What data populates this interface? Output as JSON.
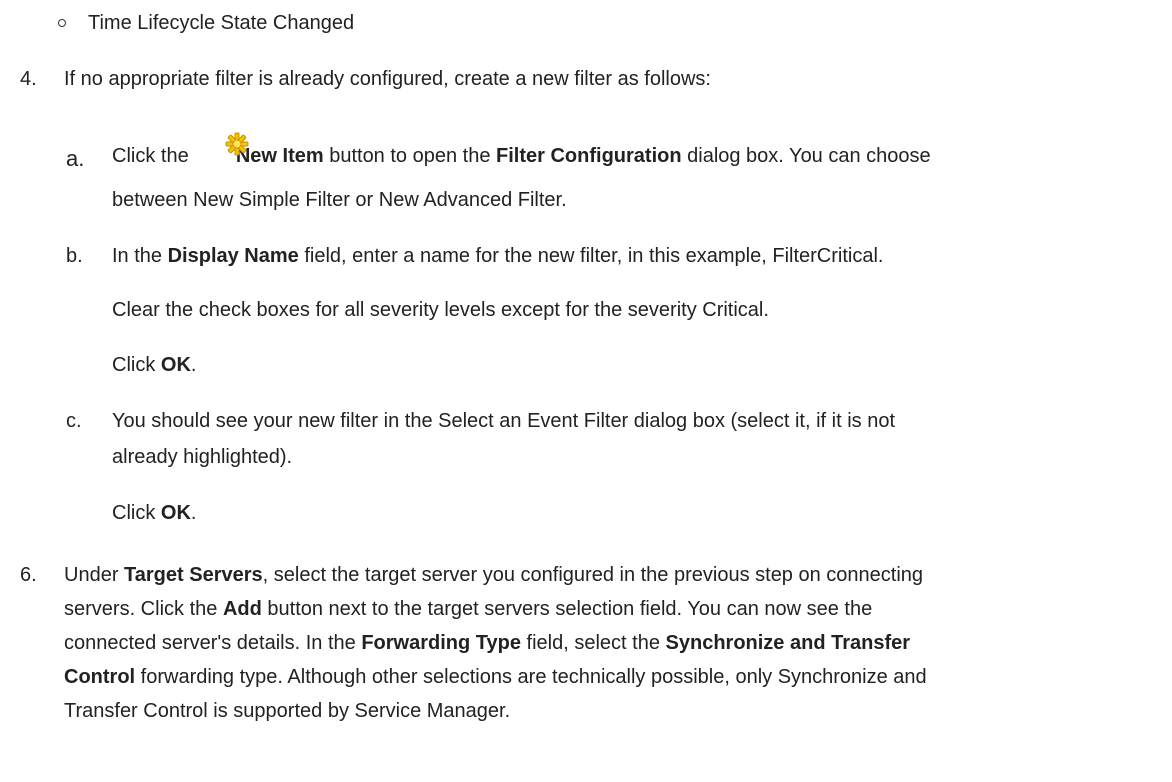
{
  "bullet_item": {
    "text": "Time Lifecycle State Changed"
  },
  "step4": {
    "number": "4.",
    "text": "If no appropriate filter is already configured, create a new filter as follows:"
  },
  "step_a": {
    "letter": "a.",
    "t1": "Click the",
    "icon": "new-item-icon",
    "b1": "New Item",
    "t2": "button to open the",
    "b2": "Filter Configuration",
    "t3": "dialog box. You can choose",
    "line2": "between New Simple Filter or New Advanced Filter."
  },
  "step_b": {
    "letter": "b.",
    "t1": "In the",
    "b1": "Display Name",
    "t2": "field, enter a name for the new filter, in this example, FilterCritical.",
    "p2": "Clear the check boxes for all severity levels except for the severity Critical.",
    "click_t": "Click",
    "click_b": "OK",
    "click_end": "."
  },
  "step_c": {
    "letter": "c.",
    "line1": "You should see your new filter in the Select an Event Filter dialog box (select it, if it is not",
    "line2": "already highlighted).",
    "click_t": "Click",
    "click_b": "OK",
    "click_end": "."
  },
  "step6": {
    "number": "6.",
    "l1_t1": "Under",
    "l1_b1": "Target Servers",
    "l1_t2": ", select the target server you configured in the previous step on connecting",
    "l2_t1": "servers. Click the",
    "l2_b1": "Add",
    "l2_t2": "button next to the target servers selection field. You can now see the",
    "l3_t1": "connected server's details. In the",
    "l3_b1": "Forwarding Type",
    "l3_t2": "field, select the",
    "l3_b2": "Synchronize and Transfer",
    "l4_b1": "Control",
    "l4_t1": "forwarding type. Although other selections are technically possible, only Synchronize and",
    "l5": "Transfer Control is supported by Service Manager."
  },
  "colors": {
    "icon_fill": "#f5c400",
    "icon_stroke": "#c89000",
    "text": "#222222"
  }
}
